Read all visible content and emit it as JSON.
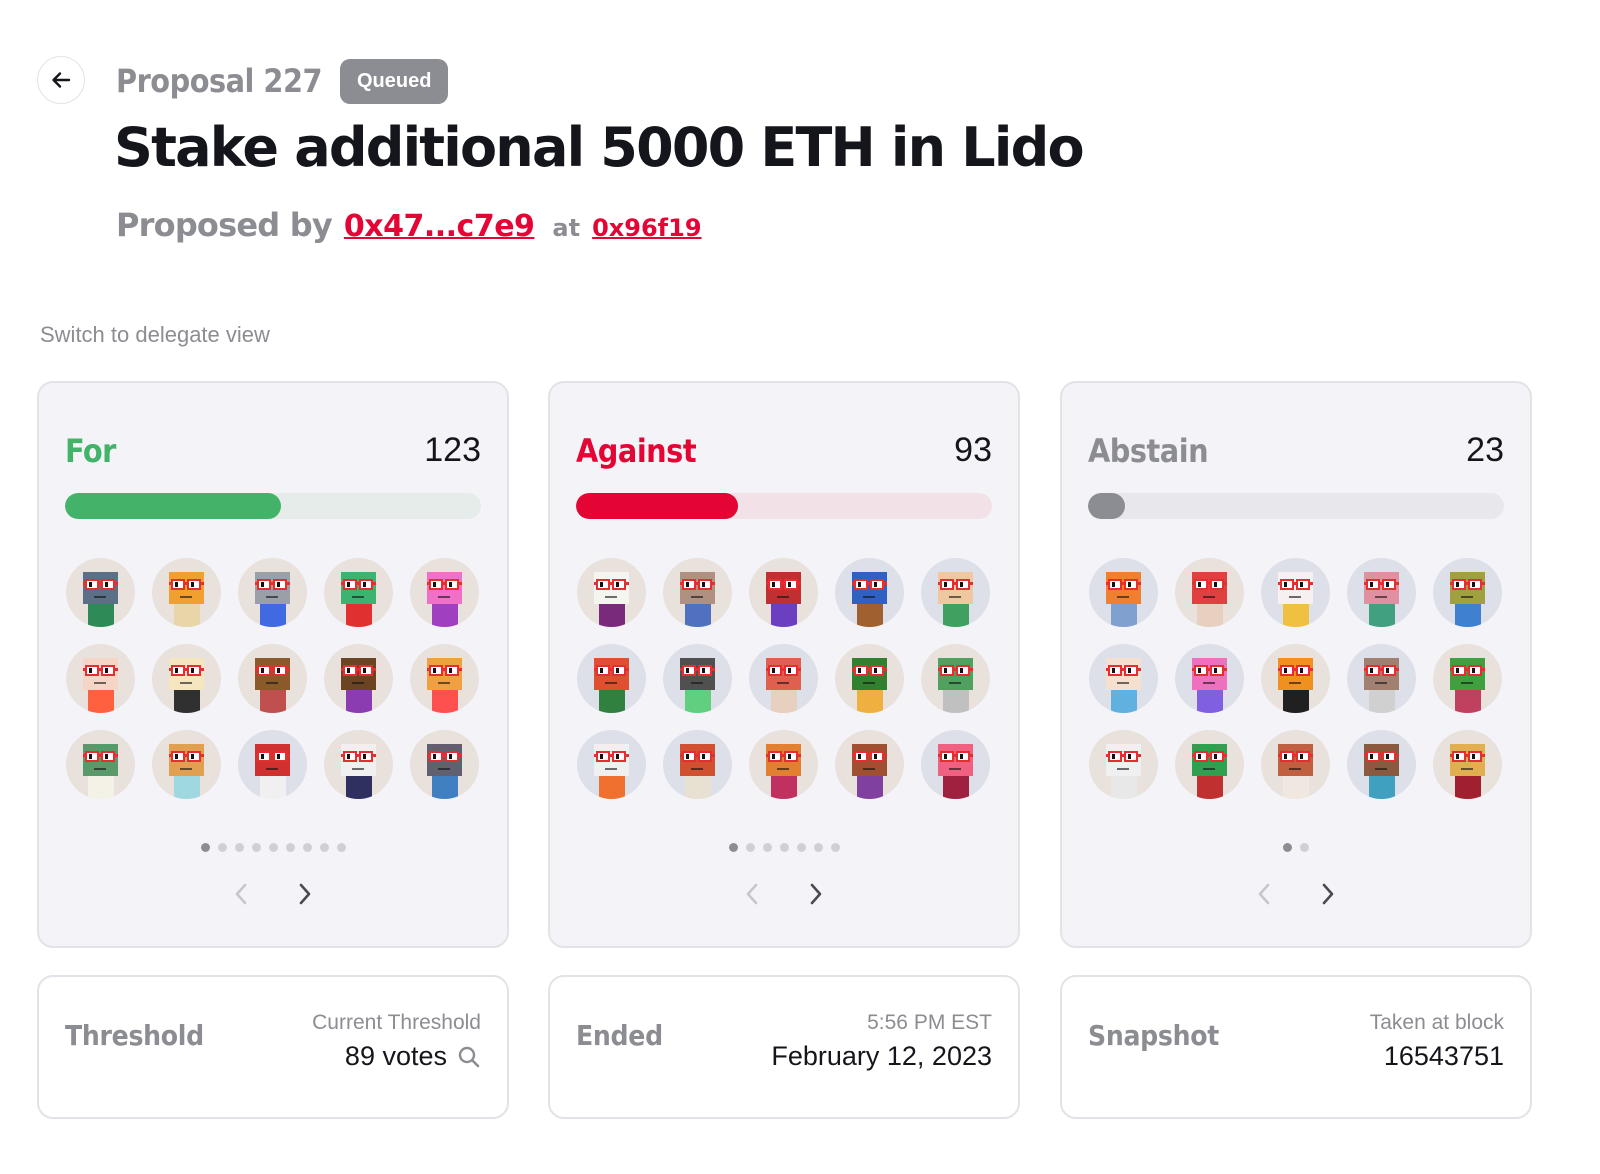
{
  "header": {
    "proposal_label": "Proposal 227",
    "status": "Queued",
    "title": "Stake additional 5000 ETH in Lido",
    "proposed_by_label": "Proposed by",
    "proposer": "0x47...c7e9",
    "at_label": "at",
    "block": "0x96f19"
  },
  "switch_view_label": "Switch to delegate view",
  "votes": {
    "for": {
      "label": "For",
      "count": "123",
      "fraction": 0.52,
      "color": "#43b369",
      "track": "#e6ece9",
      "pages": 9,
      "active_page": 0,
      "avatars": [
        {
          "head": "#5b6f86",
          "body": "#2e8b57",
          "bg": "#e8e1dc"
        },
        {
          "head": "#f0a030",
          "body": "#e8d6a8",
          "bg": "#e8e1dc"
        },
        {
          "head": "#9aa0a8",
          "body": "#4169e1",
          "bg": "#e8e1dc"
        },
        {
          "head": "#3cb371",
          "body": "#e03030",
          "bg": "#e8e1dc"
        },
        {
          "head": "#f070c8",
          "body": "#a040c0",
          "bg": "#e8e1dc"
        },
        {
          "head": "#f5d6c6",
          "body": "#ff6040",
          "bg": "#e8e1dc"
        },
        {
          "head": "#f5e6c0",
          "body": "#303030",
          "bg": "#e8e1dc"
        },
        {
          "head": "#8b5a2b",
          "body": "#c0504d",
          "bg": "#e8e1dc"
        },
        {
          "head": "#6b4423",
          "body": "#8a3cb0",
          "bg": "#e8e1dc"
        },
        {
          "head": "#f0a040",
          "body": "#ff5050",
          "bg": "#e8e1dc"
        },
        {
          "head": "#5a9a6a",
          "body": "#f4f1e6",
          "bg": "#e8e1dc"
        },
        {
          "head": "#e0a050",
          "body": "#a0d8e0",
          "bg": "#e8e1dc"
        },
        {
          "head": "#d03030",
          "body": "#f0f0f0",
          "bg": "#dde0e8"
        },
        {
          "head": "#f0f0f0",
          "body": "#303060",
          "bg": "#e8e1dc"
        },
        {
          "head": "#606070",
          "body": "#4080c0",
          "bg": "#e8e1dc"
        }
      ]
    },
    "against": {
      "label": "Against",
      "count": "93",
      "fraction": 0.39,
      "color": "#e40535",
      "track": "#f2e1e6",
      "pages": 7,
      "active_page": 0,
      "avatars": [
        {
          "head": "#f5f5f0",
          "body": "#7a2a7a",
          "bg": "#e8e1dc"
        },
        {
          "head": "#b09080",
          "body": "#5070c0",
          "bg": "#e8e1dc"
        },
        {
          "head": "#c03030",
          "body": "#6a40c0",
          "bg": "#e8e1dc"
        },
        {
          "head": "#3060c0",
          "body": "#a06030",
          "bg": "#dde0e8"
        },
        {
          "head": "#f0c8a0",
          "body": "#40a060",
          "bg": "#dde0e8"
        },
        {
          "head": "#e05030",
          "body": "#308040",
          "bg": "#dde0e8"
        },
        {
          "head": "#505050",
          "body": "#60d080",
          "bg": "#dde0e8"
        },
        {
          "head": "#e06050",
          "body": "#e8d0c0",
          "bg": "#dde0e8"
        },
        {
          "head": "#308030",
          "body": "#f0b040",
          "bg": "#e8e1dc"
        },
        {
          "head": "#50a060",
          "body": "#c0c0c0",
          "bg": "#e8e1dc"
        },
        {
          "head": "#f0f0f0",
          "body": "#f07030",
          "bg": "#dde0e8"
        },
        {
          "head": "#d05030",
          "body": "#e8e0d0",
          "bg": "#dde0e8"
        },
        {
          "head": "#e08030",
          "body": "#c03060",
          "bg": "#e8e1dc"
        },
        {
          "head": "#a05030",
          "body": "#8040a0",
          "bg": "#e8e1dc"
        },
        {
          "head": "#f06080",
          "body": "#a02040",
          "bg": "#dde0e8"
        }
      ]
    },
    "abstain": {
      "label": "Abstain",
      "count": "23",
      "fraction": 0.09,
      "color": "#8c8d92",
      "track": "#e8e8ec",
      "pages": 2,
      "active_page": 0,
      "avatars": [
        {
          "head": "#f08030",
          "body": "#80a0d0",
          "bg": "#dde0e8"
        },
        {
          "head": "#e04040",
          "body": "#e8d0c0",
          "bg": "#e8e1dc"
        },
        {
          "head": "#f8f0f0",
          "body": "#f0c040",
          "bg": "#dde0e8"
        },
        {
          "head": "#e090a0",
          "body": "#40a080",
          "bg": "#dde0e8"
        },
        {
          "head": "#a0a040",
          "body": "#4080d0",
          "bg": "#dde0e8"
        },
        {
          "head": "#f5e0d0",
          "body": "#60b0e0",
          "bg": "#dde0e8"
        },
        {
          "head": "#f070c0",
          "body": "#8060e0",
          "bg": "#dde0e8"
        },
        {
          "head": "#f09020",
          "body": "#202020",
          "bg": "#e8e1dc"
        },
        {
          "head": "#a08070",
          "body": "#d0d0d0",
          "bg": "#dde0e8"
        },
        {
          "head": "#40a040",
          "body": "#c04060",
          "bg": "#e8e1dc"
        },
        {
          "head": "#f0f0f0",
          "body": "#e8e8e8",
          "bg": "#e8e1dc"
        },
        {
          "head": "#30a050",
          "body": "#c03030",
          "bg": "#e8e1dc"
        },
        {
          "head": "#c06040",
          "body": "#f0e8e0",
          "bg": "#e8e1dc"
        },
        {
          "head": "#8a5a40",
          "body": "#40a0c0",
          "bg": "#dde0e8"
        },
        {
          "head": "#e0b050",
          "body": "#a02030",
          "bg": "#e8e1dc"
        }
      ]
    }
  },
  "threshold": {
    "label": "Threshold",
    "sub": "Current Threshold",
    "value": "89 votes",
    "icon": "search-icon"
  },
  "ended": {
    "label": "Ended",
    "sub": "5:56 PM EST",
    "value": "February 12, 2023"
  },
  "snapshot": {
    "label": "Snapshot",
    "sub": "Taken at block",
    "value": "16543751"
  }
}
